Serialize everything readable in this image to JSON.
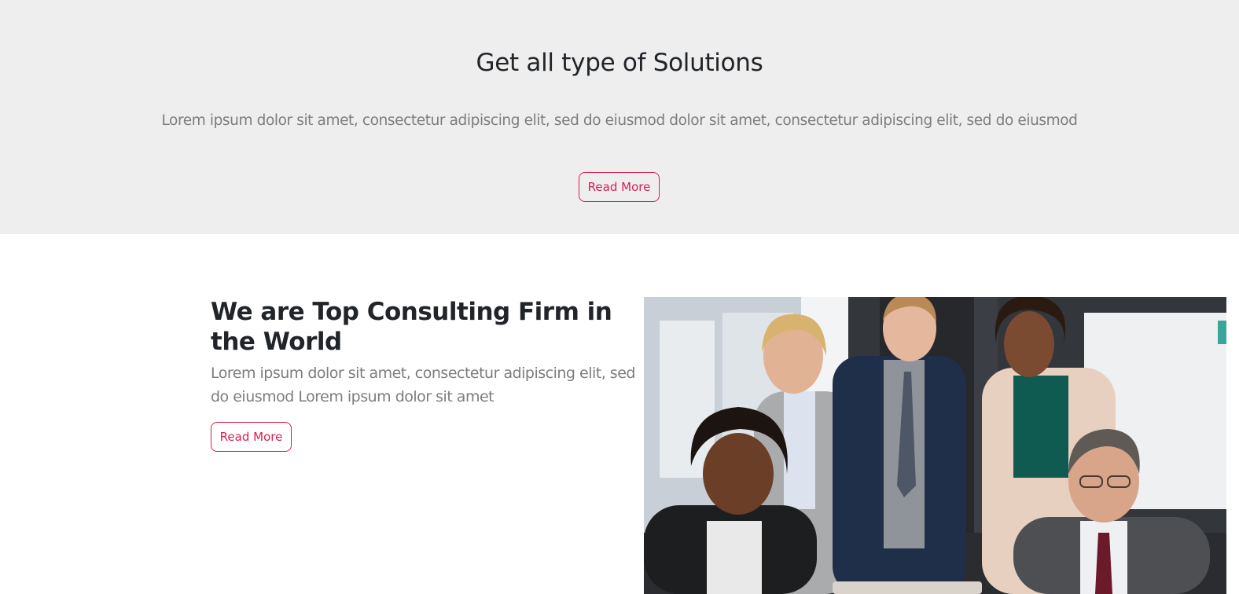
{
  "solutions": {
    "title": "Get all type of Solutions",
    "text": "Lorem ipsum dolor sit amet, consectetur adipiscing elit, sed do eiusmod dolor sit amet, consectetur adipiscing elit, sed do eiusmod",
    "button_label": "Read More"
  },
  "firm": {
    "title": "We are Top Consulting Firm in the World",
    "text": "Lorem ipsum dolor sit amet, consectetur adipiscing elit, sed do eiusmod Lorem ipsum dolor sit amet",
    "button_label": "Read More",
    "image_subject": "team-photo"
  },
  "colors": {
    "accent": "#d81e50",
    "section_bg": "#eeeeee",
    "heading": "#212529",
    "body_text": "#7d7d7d"
  }
}
